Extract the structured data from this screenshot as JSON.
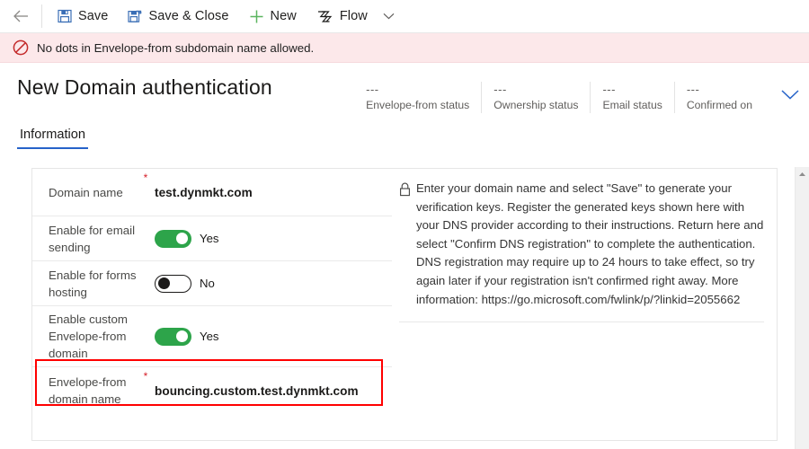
{
  "commandbar": {
    "back_icon": "arrow-left-icon",
    "items": [
      {
        "id": "save",
        "label": "Save",
        "icon": "save-disk-icon"
      },
      {
        "id": "save-close",
        "label": "Save & Close",
        "icon": "save-and-close-icon"
      },
      {
        "id": "new",
        "label": "New",
        "icon": "plus-icon"
      },
      {
        "id": "flow",
        "label": "Flow",
        "icon": "flow-icon"
      }
    ],
    "overflow_icon": "chevron-down-icon"
  },
  "error_banner": {
    "icon": "prohibition-icon",
    "message": "No dots in Envelope-from subdomain name allowed.",
    "background": "#fce8ea",
    "icon_color": "#d6202a"
  },
  "header": {
    "title": "New Domain authentication",
    "expand_icon": "chevron-down-icon",
    "stats": [
      {
        "value": "---",
        "label": "Envelope-from status"
      },
      {
        "value": "---",
        "label": "Ownership status"
      },
      {
        "value": "---",
        "label": "Email status"
      },
      {
        "value": "---",
        "label": "Confirmed on"
      }
    ]
  },
  "tabs": [
    {
      "id": "information",
      "label": "Information",
      "active": true
    }
  ],
  "form": {
    "rows": [
      {
        "id": "domain-name",
        "label": "Domain name",
        "required": true,
        "required_mark": "*",
        "type": "text",
        "value": "test.dynmkt.com"
      },
      {
        "id": "enable-email-sending",
        "label": "Enable for email sending",
        "required": false,
        "type": "toggle",
        "state": "on",
        "value": "Yes"
      },
      {
        "id": "enable-forms-hosting",
        "label": "Enable for forms hosting",
        "required": false,
        "type": "toggle",
        "state": "off",
        "value": "No"
      },
      {
        "id": "enable-custom-envelope-from-domain",
        "label": "Enable custom Envelope-from domain",
        "required": false,
        "type": "toggle",
        "state": "on",
        "value": "Yes"
      },
      {
        "id": "envelope-from-domain-name",
        "label": "Envelope-from domain name",
        "required": true,
        "required_mark": "*",
        "type": "text",
        "value": "bouncing.custom.test.dynmkt.com",
        "highlighted": true
      }
    ]
  },
  "info_panel": {
    "icon": "lock-icon",
    "text": "Enter your domain name and select \"Save\" to generate your verification keys. Register the generated keys shown here with your DNS provider according to their instructions. Return here and select \"Confirm DNS registration\" to complete the authentication. DNS registration may require up to 24 hours to take effect, so try again later if your registration isn't confirmed right away. More information: https://go.microsoft.com/fwlink/p/?linkid=2055662"
  },
  "scrollbar": {
    "up_icon": "scroll-up-arrow-icon"
  },
  "colors": {
    "accent": "#2663c9",
    "toggle_on": "#2da44a",
    "error_red": "#d6202a",
    "highlight": "#ff0000",
    "new_green": "#4caf50"
  }
}
